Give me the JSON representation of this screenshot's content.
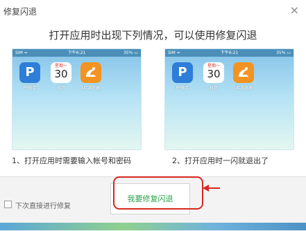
{
  "window": {
    "title": "修复闪退",
    "close_glyph": "×"
  },
  "headline": "打开应用时出现下列情况，可以使用修复闪退",
  "statusbar": {
    "carrier": "SIM ≈",
    "time": "下午6:21",
    "battery": "35% ▭"
  },
  "apps": {
    "pp": {
      "glyph": "P",
      "label": "PP助手"
    },
    "calendar": {
      "weekday": "星期一",
      "day": "30",
      "label": "日历"
    },
    "uc": {
      "label": "UC浏览器"
    }
  },
  "captions": {
    "left": "1、打开应用时需要输入帐号和密码",
    "right": "2、打开应用时一闪就退出了"
  },
  "footer": {
    "checkbox_label": "下次直接进行修复",
    "fix_button_label": "我要修复闪退"
  },
  "colors": {
    "button_text": "#2aa34a",
    "highlight": "#d8261d",
    "status_bar": "#4b8fb8"
  }
}
